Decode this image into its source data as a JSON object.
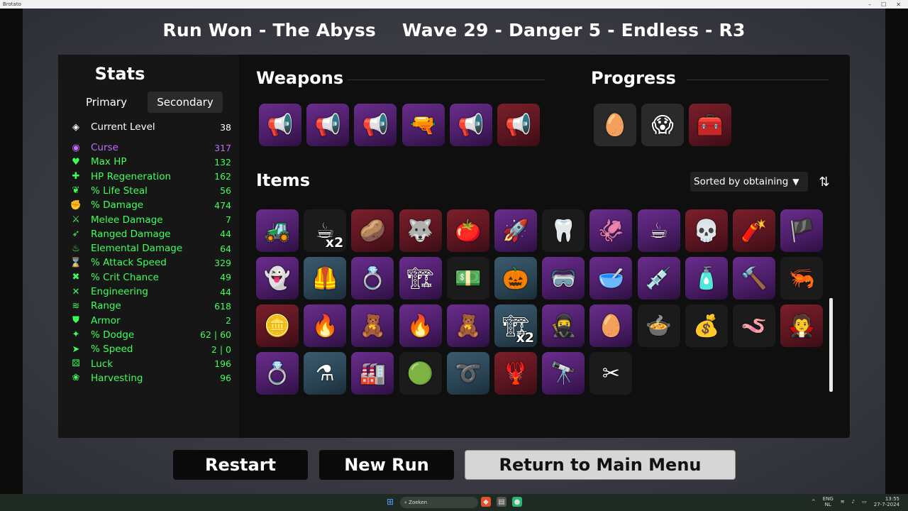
{
  "window": {
    "title": "Brotato",
    "controls": [
      "–",
      "☐",
      "✕"
    ]
  },
  "header": {
    "run_result": "Run Won - The Abyss",
    "run_info": "Wave 29 - Danger 5 - Endless - R3"
  },
  "stats": {
    "title": "Stats",
    "tabs": {
      "primary": "Primary",
      "secondary": "Secondary"
    },
    "level": {
      "label": "Current Level",
      "value": "38",
      "icon": "level-icon",
      "color": "#ffffff"
    },
    "rows": [
      {
        "label": "Curse",
        "value": "317",
        "icon": "curse-icon",
        "color": "#c26cff",
        "glyph": "◉"
      },
      {
        "label": "Max HP",
        "value": "132",
        "icon": "heart-icon",
        "color": "#3cff5a",
        "glyph": "♥"
      },
      {
        "label": "HP Regeneration",
        "value": "162",
        "icon": "regen-icon",
        "color": "#3cff5a",
        "glyph": "✚"
      },
      {
        "label": "% Life Steal",
        "value": "56",
        "icon": "lifesteal-icon",
        "color": "#3cff5a",
        "glyph": "❦"
      },
      {
        "label": "% Damage",
        "value": "474",
        "icon": "damage-icon",
        "color": "#3cff5a",
        "glyph": "✊"
      },
      {
        "label": "Melee Damage",
        "value": "7",
        "icon": "sword-icon",
        "color": "#3cff5a",
        "glyph": "⚔"
      },
      {
        "label": "Ranged Damage",
        "value": "44",
        "icon": "bow-icon",
        "color": "#3cff5a",
        "glyph": "➶"
      },
      {
        "label": "Elemental Damage",
        "value": "64",
        "icon": "flame-icon",
        "color": "#3cff5a",
        "glyph": "♨"
      },
      {
        "label": "% Attack Speed",
        "value": "329",
        "icon": "hourglass-icon",
        "color": "#3cff5a",
        "glyph": "⌛"
      },
      {
        "label": "% Crit Chance",
        "value": "49",
        "icon": "crit-icon",
        "color": "#3cff5a",
        "glyph": "✖"
      },
      {
        "label": "Engineering",
        "value": "44",
        "icon": "wrench-icon",
        "color": "#3cff5a",
        "glyph": "✕"
      },
      {
        "label": "Range",
        "value": "618",
        "icon": "range-icon",
        "color": "#3cff5a",
        "glyph": "≋"
      },
      {
        "label": "Armor",
        "value": "2",
        "icon": "shield-icon",
        "color": "#3cff5a",
        "glyph": "⛊"
      },
      {
        "label": "% Dodge",
        "value": "62 | 60",
        "icon": "dodge-icon",
        "color": "#3cff5a",
        "glyph": "✦"
      },
      {
        "label": "% Speed",
        "value": "2 | 0",
        "icon": "speed-icon",
        "color": "#3cff5a",
        "glyph": "➤"
      },
      {
        "label": "Luck",
        "value": "196",
        "icon": "dice-icon",
        "color": "#3cff5a",
        "glyph": "⚄"
      },
      {
        "label": "Harvesting",
        "value": "96",
        "icon": "harvest-icon",
        "color": "#3cff5a",
        "glyph": "❀"
      }
    ]
  },
  "weapons": {
    "title": "Weapons",
    "slots": [
      {
        "icon": "megaphone-weapon-icon",
        "glyph": "📢",
        "tier": "purple"
      },
      {
        "icon": "megaphone-weapon-icon",
        "glyph": "📢",
        "tier": "purple"
      },
      {
        "icon": "megaphone-weapon-icon",
        "glyph": "📢",
        "tier": "purple"
      },
      {
        "icon": "cannon-weapon-icon",
        "glyph": "🔫",
        "tier": "purple"
      },
      {
        "icon": "megaphone-weapon-icon",
        "glyph": "📢",
        "tier": "purple"
      },
      {
        "icon": "megaphone-weapon-icon",
        "glyph": "📢",
        "tier": "red"
      }
    ]
  },
  "progress": {
    "title": "Progress",
    "slots": [
      {
        "icon": "egg-character-icon",
        "glyph": "🥚",
        "tier": "dark"
      },
      {
        "icon": "danger-face-icon",
        "glyph": "😱",
        "tier": "dark"
      },
      {
        "icon": "medkit-icon",
        "glyph": "🧰",
        "tier": "red"
      }
    ]
  },
  "items": {
    "title": "Items",
    "sort_label": "Sorted by obtaining",
    "rows": [
      [
        {
          "icon": "tractor-item-icon",
          "glyph": "🚜",
          "tier": "purple",
          "count": ""
        },
        {
          "icon": "cup-item-icon",
          "glyph": "☕",
          "tier": "black",
          "count": "x2"
        },
        {
          "icon": "potato-item-icon",
          "glyph": "🥔",
          "tier": "red",
          "count": ""
        },
        {
          "icon": "wolf-item-icon",
          "glyph": "🐺",
          "tier": "red",
          "count": ""
        },
        {
          "icon": "tomato-item-icon",
          "glyph": "🍅",
          "tier": "red",
          "count": ""
        },
        {
          "icon": "rocket-item-icon",
          "glyph": "🚀",
          "tier": "purple",
          "count": ""
        },
        {
          "icon": "tooth-item-icon",
          "glyph": "🦷",
          "tier": "black",
          "count": ""
        },
        {
          "icon": "tentacle-item-icon",
          "glyph": "🦑",
          "tier": "purple",
          "count": ""
        },
        {
          "icon": "coffee-item-icon",
          "glyph": "☕",
          "tier": "purple",
          "count": ""
        },
        {
          "icon": "scroll-item-icon",
          "glyph": "💀",
          "tier": "red",
          "count": ""
        },
        {
          "icon": "bullet-item-icon",
          "glyph": "🧨",
          "tier": "red",
          "count": ""
        },
        {
          "icon": "flag-item-icon",
          "glyph": "🏴",
          "tier": "purple",
          "count": ""
        }
      ],
      [
        {
          "icon": "ghost-item-icon",
          "glyph": "👻",
          "tier": "purple",
          "count": ""
        },
        {
          "icon": "armor-item-icon",
          "glyph": "🦺",
          "tier": "blue",
          "count": ""
        },
        {
          "icon": "ring-item-icon",
          "glyph": "💍",
          "tier": "purple",
          "count": ""
        },
        {
          "icon": "crane-item-icon",
          "glyph": "🏗",
          "tier": "purple",
          "count": ""
        },
        {
          "icon": "banknote-item-icon",
          "glyph": "💵",
          "tier": "black",
          "count": ""
        },
        {
          "icon": "pumpkin-item-icon",
          "glyph": "🎃",
          "tier": "blue",
          "count": ""
        },
        {
          "icon": "goggles-item-icon",
          "glyph": "🥽",
          "tier": "purple",
          "count": ""
        },
        {
          "icon": "mortar-item-icon",
          "glyph": "🥣",
          "tier": "purple",
          "count": ""
        },
        {
          "icon": "syringe-item-icon",
          "glyph": "💉",
          "tier": "purple",
          "count": ""
        },
        {
          "icon": "bottle-item-icon",
          "glyph": "🧴",
          "tier": "purple",
          "count": ""
        },
        {
          "icon": "hammer-item-icon",
          "glyph": "🔨",
          "tier": "purple",
          "count": ""
        },
        {
          "icon": "shrimp-item-icon",
          "glyph": "🦐",
          "tier": "black",
          "count": ""
        }
      ],
      [
        {
          "icon": "coin-item-icon",
          "glyph": "🪙",
          "tier": "red",
          "count": ""
        },
        {
          "icon": "blue-flame-item-icon",
          "glyph": "🔥",
          "tier": "purple",
          "count": ""
        },
        {
          "icon": "scarecrow-item-icon",
          "glyph": "🧸",
          "tier": "purple",
          "count": ""
        },
        {
          "icon": "campfire-item-icon",
          "glyph": "🔥",
          "tier": "purple",
          "count": ""
        },
        {
          "icon": "scarecrow-item-icon",
          "glyph": "🧸",
          "tier": "purple",
          "count": ""
        },
        {
          "icon": "crane-item-icon",
          "glyph": "🏗",
          "tier": "blue",
          "count": "x2"
        },
        {
          "icon": "ninja-item-icon",
          "glyph": "🥷",
          "tier": "purple",
          "count": ""
        },
        {
          "icon": "egg-item-icon",
          "glyph": "🥚",
          "tier": "purple",
          "count": ""
        },
        {
          "icon": "cauldron-item-icon",
          "glyph": "🍲",
          "tier": "black",
          "count": ""
        },
        {
          "icon": "sack-item-icon",
          "glyph": "💰",
          "tier": "black",
          "count": ""
        },
        {
          "icon": "worm-item-icon",
          "glyph": "🪱",
          "tier": "black",
          "count": ""
        },
        {
          "icon": "vampire-item-icon",
          "glyph": "🧛",
          "tier": "red",
          "count": ""
        }
      ],
      [
        {
          "icon": "ring-item-icon",
          "glyph": "💍",
          "tier": "purple",
          "count": ""
        },
        {
          "icon": "potion-item-icon",
          "glyph": "⚗",
          "tier": "blue",
          "count": ""
        },
        {
          "icon": "factory-item-icon",
          "glyph": "🏭",
          "tier": "purple",
          "count": ""
        },
        {
          "icon": "slime-item-icon",
          "glyph": "🟢",
          "tier": "black",
          "count": ""
        },
        {
          "icon": "lasso-item-icon",
          "glyph": "➰",
          "tier": "blue",
          "count": ""
        },
        {
          "icon": "claw-item-icon",
          "glyph": "🦞",
          "tier": "red",
          "count": ""
        },
        {
          "icon": "spyglass-item-icon",
          "glyph": "🔭",
          "tier": "purple",
          "count": ""
        },
        {
          "icon": "wire-item-icon",
          "glyph": "✂",
          "tier": "black",
          "count": ""
        }
      ]
    ]
  },
  "buttons": {
    "restart": "Restart",
    "new_run": "New Run",
    "main_menu": "Return to Main Menu"
  },
  "taskbar": {
    "search_placeholder": "Zoeken",
    "lang": "ENG",
    "region": "NL",
    "time": "13:55",
    "date": "27-7-2024"
  }
}
